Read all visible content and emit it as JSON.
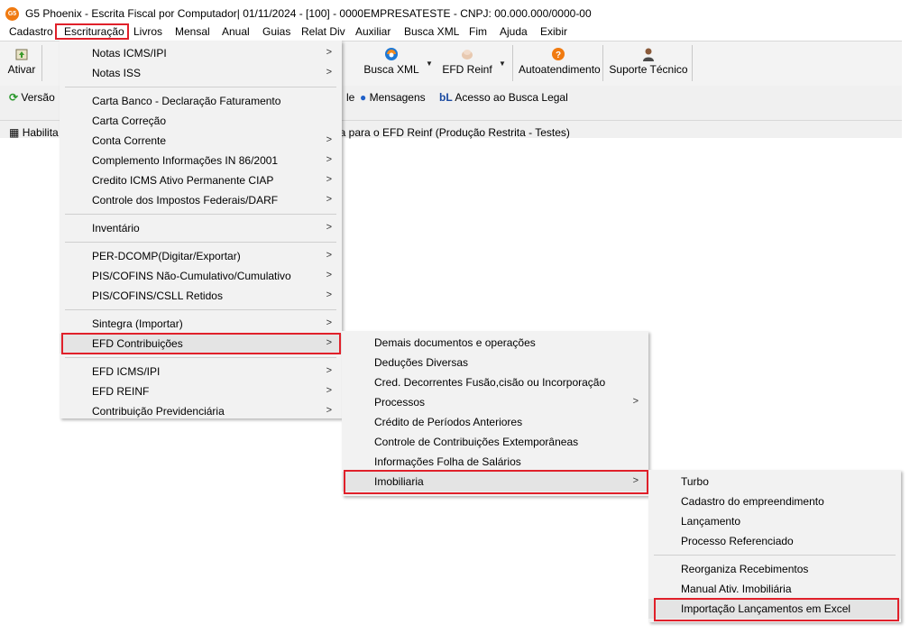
{
  "window": {
    "title": "G5 Phoenix - Escrita Fiscal por Computador|  01/11/2024 - [100] - 0000EMPRESATESTE - CNPJ: 00.000.000/0000-00",
    "icon_text": "G5"
  },
  "menubar": {
    "items": [
      "Cadastro",
      "Escrituração",
      "Livros",
      "Mensal",
      "Anual",
      "Guias",
      "Relat Div",
      "Auxiliar",
      "Busca XML",
      "Fim",
      "Ajuda",
      "Exibir"
    ],
    "highlighted": "Escrituração"
  },
  "toolbar": {
    "ativar": "Ativar",
    "busca_xml": "Busca XML",
    "efd_reinf": "EFD Reinf",
    "autoatendimento": "Autoatendimento",
    "suporte_tecnico": "Suporte Técnico"
  },
  "toolbar2": {
    "versao": "Versão",
    "partial": "le",
    "mensagens": "Mensagens",
    "acesso": "Acesso ao Busca Legal"
  },
  "statusline": {
    "habilita": "Habilita",
    "reinf_text": "da para o EFD Reinf (Produção Restrita - Testes)"
  },
  "menu1": {
    "items": [
      {
        "label": "Notas ICMS/IPI",
        "submenu": true
      },
      {
        "label": "Notas ISS",
        "submenu": true
      },
      {
        "label": "Carta Banco - Declaração Faturamento",
        "submenu": false
      },
      {
        "label": "Carta Correção",
        "submenu": false
      },
      {
        "label": "Conta Corrente",
        "submenu": true
      },
      {
        "label": "Complemento Informações IN 86/2001",
        "submenu": true
      },
      {
        "label": "Credito ICMS Ativo Permanente CIAP",
        "submenu": true
      },
      {
        "label": "Controle dos Impostos Federais/DARF",
        "submenu": true
      },
      {
        "label": "Inventário",
        "submenu": true
      },
      {
        "label": "PER-DCOMP(Digitar/Exportar)",
        "submenu": true
      },
      {
        "label": "PIS/COFINS Não-Cumulativo/Cumulativo",
        "submenu": true
      },
      {
        "label": "PIS/COFINS/CSLL Retidos",
        "submenu": true
      },
      {
        "label": "Sintegra (Importar)",
        "submenu": true
      },
      {
        "label": "EFD Contribuições",
        "submenu": true
      },
      {
        "label": "EFD ICMS/IPI",
        "submenu": true
      },
      {
        "label": "EFD REINF",
        "submenu": true
      },
      {
        "label": "Contribuição Previdenciária",
        "submenu": true
      }
    ],
    "highlighted": "EFD Contribuições"
  },
  "menu2": {
    "items": [
      {
        "label": "Demais documentos e operações",
        "submenu": false
      },
      {
        "label": "Deduções Diversas",
        "submenu": false
      },
      {
        "label": "Cred. Decorrentes Fusão,cisão ou Incorporação",
        "submenu": false
      },
      {
        "label": "Processos",
        "submenu": true
      },
      {
        "label": "Crédito de Períodos Anteriores",
        "submenu": false
      },
      {
        "label": "Controle de Contribuições Extemporâneas",
        "submenu": false
      },
      {
        "label": "Informações Folha de Salários",
        "submenu": false
      },
      {
        "label": "Imobiliaria",
        "submenu": true
      }
    ],
    "highlighted": "Imobiliaria"
  },
  "menu3": {
    "items": [
      {
        "label": "Turbo",
        "submenu": false
      },
      {
        "label": "Cadastro do empreendimento",
        "submenu": false
      },
      {
        "label": "Lançamento",
        "submenu": false
      },
      {
        "label": "Processo Referenciado",
        "submenu": false
      },
      {
        "label": "Reorganiza Recebimentos",
        "submenu": false
      },
      {
        "label": "Manual Ativ. Imobiliária",
        "submenu": false
      },
      {
        "label": "Importação Lançamentos em Excel",
        "submenu": false
      }
    ],
    "highlighted": "Importação Lançamentos em Excel"
  },
  "colors": {
    "highlight_border": "#e0202a",
    "menu_bg": "#f2f2f2",
    "toolbar_bg": "#f3f3f3",
    "app_icon": "#f07a10"
  }
}
